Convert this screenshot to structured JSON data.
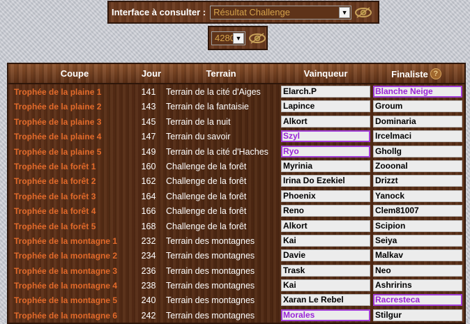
{
  "interface": {
    "label": "Interface à consulter :",
    "selected": "Résultat Challenge",
    "eye_icon": "eye-icon"
  },
  "year_selector": {
    "selected": "4280"
  },
  "table": {
    "headers": {
      "coupe": "Coupe",
      "jour": "Jour",
      "terrain": "Terrain",
      "vainqueur": "Vainqueur",
      "finaliste": "Finaliste",
      "help_glyph": "?"
    },
    "colors": {
      "coupe_text": "#e36a2a",
      "highlight_border": "#a13fd6",
      "highlight_text": "#9a24d8"
    },
    "rows": [
      {
        "coupe": "Trophée de la plaine 1",
        "jour": "141",
        "terrain": "Terrain de la cité d'Aiges",
        "vainqueur": "Elarch.P",
        "vainqueur_hl": false,
        "finaliste": "Blanche Neige",
        "finaliste_hl": true
      },
      {
        "coupe": "Trophée de la plaine 2",
        "jour": "143",
        "terrain": "Terrain de la fantaisie",
        "vainqueur": "Lapince",
        "vainqueur_hl": false,
        "finaliste": "Groum",
        "finaliste_hl": false
      },
      {
        "coupe": "Trophée de la plaine 3",
        "jour": "145",
        "terrain": "Terrain de la nuit",
        "vainqueur": "Alkort",
        "vainqueur_hl": false,
        "finaliste": "Dominaria",
        "finaliste_hl": false
      },
      {
        "coupe": "Trophée de la plaine 4",
        "jour": "147",
        "terrain": "Terrain du savoir",
        "vainqueur": "Szyl",
        "vainqueur_hl": true,
        "finaliste": "Ircelmaci",
        "finaliste_hl": false
      },
      {
        "coupe": "Trophée de la plaine 5",
        "jour": "149",
        "terrain": "Terrain de la cité d'Haches",
        "vainqueur": "Ryo",
        "vainqueur_hl": true,
        "finaliste": "Ghollg",
        "finaliste_hl": false
      },
      {
        "coupe": "Trophée de la forêt 1",
        "jour": "160",
        "terrain": "Challenge de la forêt",
        "vainqueur": "Myrinia",
        "vainqueur_hl": false,
        "finaliste": "Zooonal",
        "finaliste_hl": false
      },
      {
        "coupe": "Trophée de la forêt 2",
        "jour": "162",
        "terrain": "Challenge de la forêt",
        "vainqueur": "Irina Do Ezekiel",
        "vainqueur_hl": false,
        "finaliste": "Drizzt",
        "finaliste_hl": false
      },
      {
        "coupe": "Trophée de la forêt 3",
        "jour": "164",
        "terrain": "Challenge de la forêt",
        "vainqueur": "Phoenix",
        "vainqueur_hl": false,
        "finaliste": "Yanock",
        "finaliste_hl": false
      },
      {
        "coupe": "Trophée de la forêt 4",
        "jour": "166",
        "terrain": "Challenge de la forêt",
        "vainqueur": "Reno",
        "vainqueur_hl": false,
        "finaliste": "Clem81007",
        "finaliste_hl": false
      },
      {
        "coupe": "Trophée de la forêt 5",
        "jour": "168",
        "terrain": "Challenge de la forêt",
        "vainqueur": "Alkort",
        "vainqueur_hl": false,
        "finaliste": "Scipion",
        "finaliste_hl": false
      },
      {
        "coupe": "Trophée de la montagne 1",
        "jour": "232",
        "terrain": "Terrain des montagnes",
        "vainqueur": "Kai",
        "vainqueur_hl": false,
        "finaliste": "Seiya",
        "finaliste_hl": false
      },
      {
        "coupe": "Trophée de la montagne 2",
        "jour": "234",
        "terrain": "Terrain des montagnes",
        "vainqueur": "Davie",
        "vainqueur_hl": false,
        "finaliste": "Malkav",
        "finaliste_hl": false
      },
      {
        "coupe": "Trophée de la montagne 3",
        "jour": "236",
        "terrain": "Terrain des montagnes",
        "vainqueur": "Trask",
        "vainqueur_hl": false,
        "finaliste": "Neo",
        "finaliste_hl": false
      },
      {
        "coupe": "Trophée de la montagne 4",
        "jour": "238",
        "terrain": "Terrain des montagnes",
        "vainqueur": "Kai",
        "vainqueur_hl": false,
        "finaliste": "Ashririns",
        "finaliste_hl": false
      },
      {
        "coupe": "Trophée de la montagne 5",
        "jour": "240",
        "terrain": "Terrain des montagnes",
        "vainqueur": "Xaran Le Rebel",
        "vainqueur_hl": false,
        "finaliste": "Racresteca",
        "finaliste_hl": true
      },
      {
        "coupe": "Trophée de la montagne 6",
        "jour": "242",
        "terrain": "Terrain des montagnes",
        "vainqueur": "Morales",
        "vainqueur_hl": true,
        "finaliste": "Stilgur",
        "finaliste_hl": false
      }
    ]
  }
}
